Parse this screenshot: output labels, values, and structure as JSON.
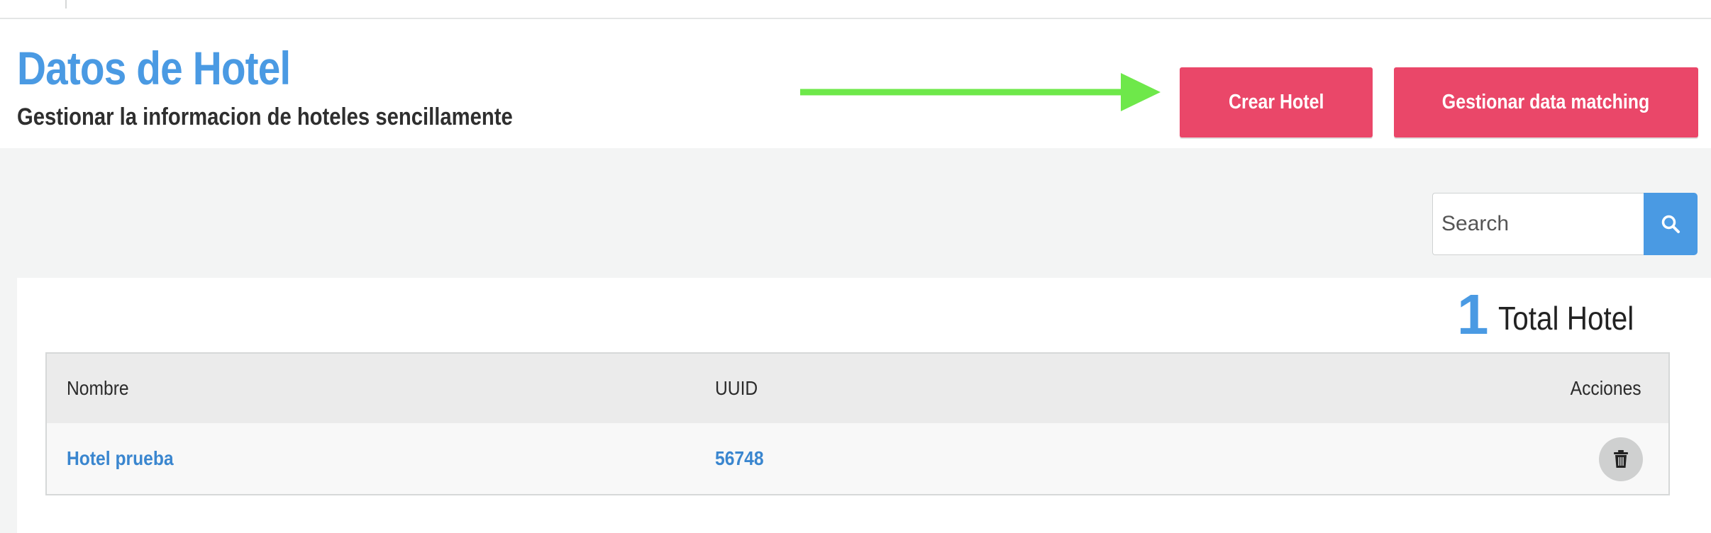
{
  "header": {
    "title": "Datos de Hotel",
    "subtitle": "Gestionar la informacion de hoteles sencillamente",
    "create_button_label": "Crear Hotel",
    "matching_button_label": "Gestionar data matching"
  },
  "search": {
    "placeholder": "Search",
    "value": ""
  },
  "summary": {
    "count": "1",
    "label": "Total Hotel"
  },
  "table": {
    "columns": [
      "Nombre",
      "UUID",
      "Acciones"
    ],
    "rows": [
      {
        "name": "Hotel prueba",
        "uuid": "56748"
      }
    ]
  },
  "icons": {
    "arrow": "arrow-right-icon",
    "search": "search-icon",
    "delete": "trash-icon"
  },
  "colors": {
    "accent_blue": "#4a9ae3",
    "primary_button": "#ea4769",
    "arrow": "#6ee84a",
    "content_background": "#f3f4f4"
  }
}
